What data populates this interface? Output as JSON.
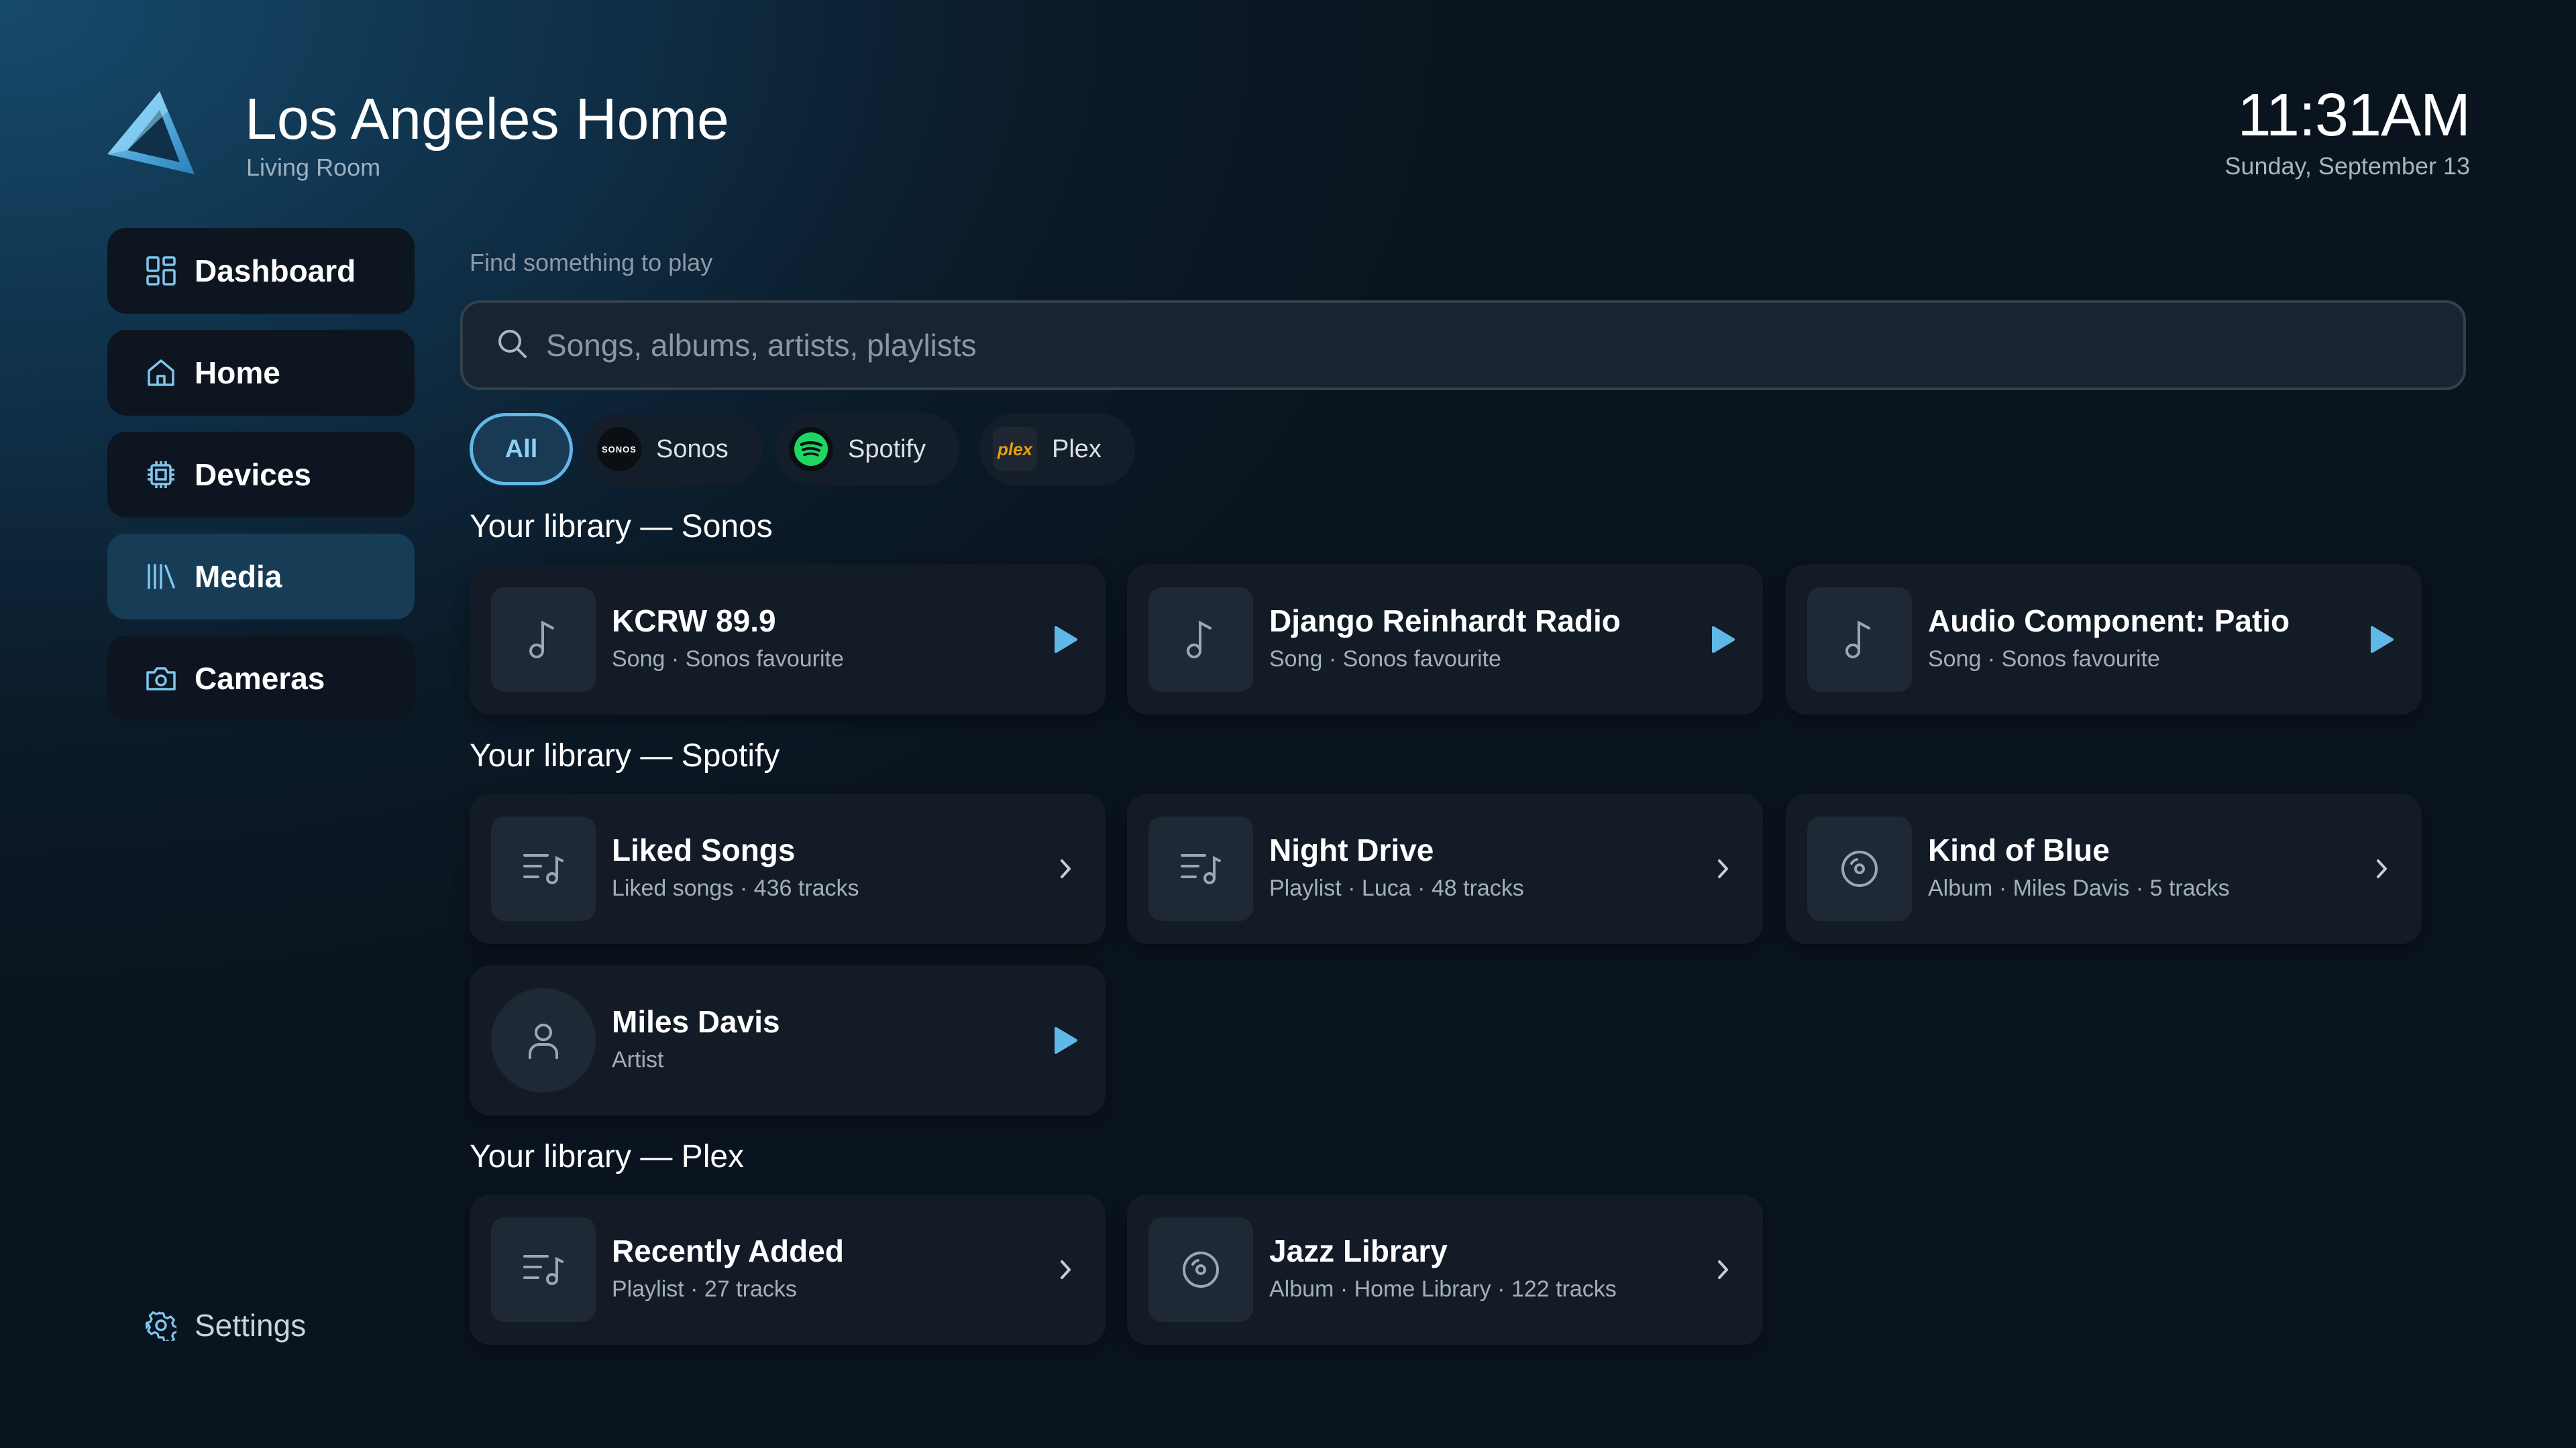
{
  "header": {
    "title": "Los Angeles Home",
    "subtitle": "Living Room",
    "time": "11:31AM",
    "date": "Sunday, September 13"
  },
  "sidebar": {
    "items": [
      {
        "label": "Dashboard",
        "icon": "grid-icon",
        "active": false
      },
      {
        "label": "Home",
        "icon": "house-icon",
        "active": false
      },
      {
        "label": "Devices",
        "icon": "chip-icon",
        "active": false
      },
      {
        "label": "Media",
        "icon": "library-icon",
        "active": true
      },
      {
        "label": "Cameras",
        "icon": "camera-icon",
        "active": false
      }
    ],
    "settings_label": "Settings"
  },
  "search": {
    "label": "Find something to play",
    "placeholder": "Songs, albums, artists, playlists"
  },
  "filters": [
    {
      "label": "All",
      "selected": true
    },
    {
      "label": "Sonos",
      "logo_text": "SONOS",
      "selected": false
    },
    {
      "label": "Spotify",
      "selected": false
    },
    {
      "label": "Plex",
      "logo_text": "plex",
      "selected": false
    }
  ],
  "sections": [
    {
      "title": "Your library — Sonos",
      "items": [
        {
          "title": "KCRW 89.9",
          "subtitle": "Song · Sonos favourite",
          "icon": "music-note-icon",
          "action": "play"
        },
        {
          "title": "Django Reinhardt Radio",
          "subtitle": "Song · Sonos favourite",
          "icon": "music-note-icon",
          "action": "play"
        },
        {
          "title": "Audio Component: Patio",
          "subtitle": "Song · Sonos favourite",
          "icon": "music-note-icon",
          "action": "play"
        }
      ]
    },
    {
      "title": "Your library — Spotify",
      "items": [
        {
          "title": "Liked Songs",
          "subtitle": "Liked songs · 436 tracks",
          "icon": "playlist-icon",
          "action": "open"
        },
        {
          "title": "Night Drive",
          "subtitle": "Playlist · Luca · 48 tracks",
          "icon": "playlist-icon",
          "action": "open"
        },
        {
          "title": "Kind of Blue",
          "subtitle": "Album · Miles Davis · 5 tracks",
          "icon": "disc-icon",
          "action": "open"
        },
        {
          "title": "Miles Davis",
          "subtitle": "Artist",
          "icon": "person-icon",
          "action": "play"
        }
      ]
    },
    {
      "title": "Your library — Plex",
      "items": [
        {
          "title": "Recently Added",
          "subtitle": "Playlist · 27 tracks",
          "icon": "playlist-icon",
          "action": "open"
        },
        {
          "title": "Jazz Library",
          "subtitle": "Album · Home Library · 122 tracks",
          "icon": "disc-icon",
          "action": "open"
        }
      ]
    }
  ],
  "colors": {
    "accent": "#5fb8e8",
    "spotify": "#1ed760",
    "plex": "#e5a00d"
  }
}
